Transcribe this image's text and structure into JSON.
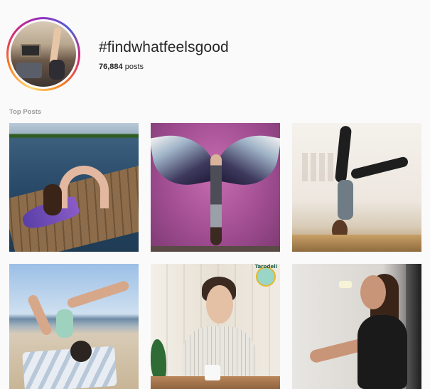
{
  "hashtag": {
    "title": "#findwhatfeelsgood",
    "post_count": "76,884",
    "post_label": "posts"
  },
  "section": {
    "label": "Top Posts"
  },
  "posts": [
    {
      "description": "mermaid-backbend-on-dock"
    },
    {
      "description": "handstand-under-wings-mural"
    },
    {
      "description": "handstand-in-white-room"
    },
    {
      "description": "beach-yoga-pose"
    },
    {
      "description": "woman-with-mug-at-table",
      "badge_text": "Tarodeli"
    },
    {
      "description": "woman-in-black-dress-drinking"
    }
  ],
  "colors": {
    "background": "#fafafa",
    "text": "#262626",
    "section_label": "#999999",
    "story_ring_start": "#feda75",
    "story_ring_end": "#d62976"
  }
}
